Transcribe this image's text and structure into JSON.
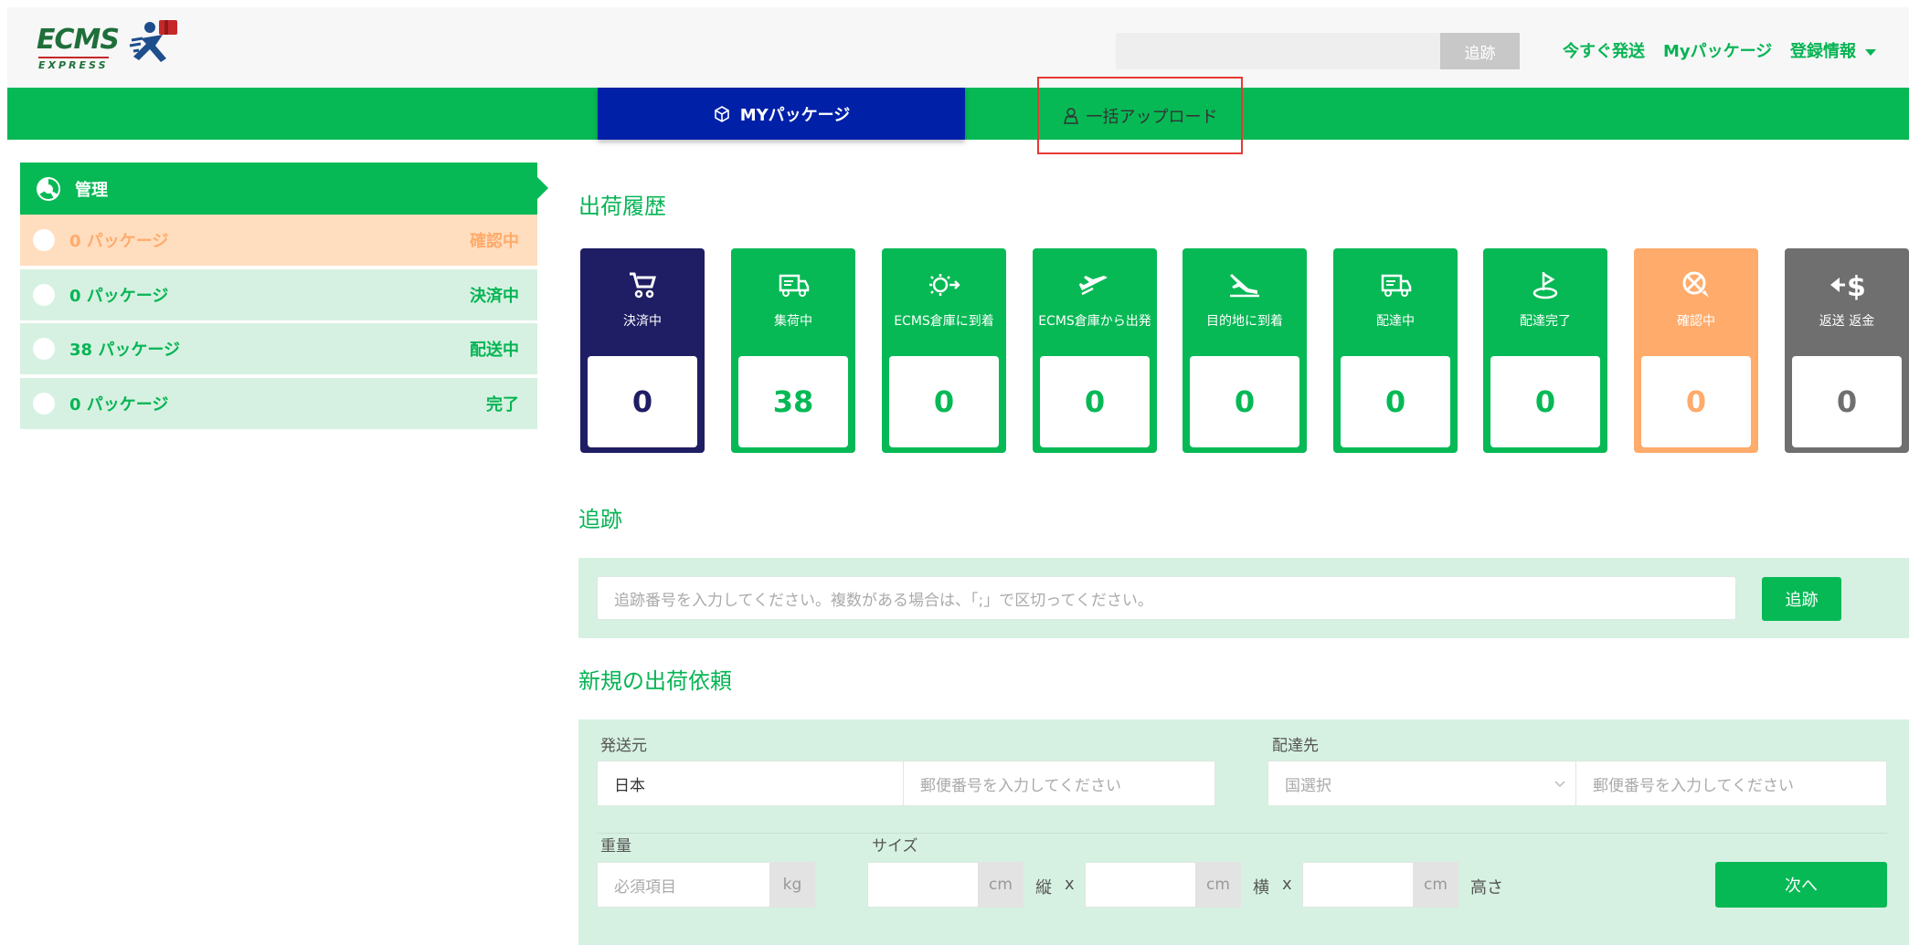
{
  "header": {
    "logo_text": "ECMS",
    "logo_sub": "EXPRESS",
    "search_placeholder": "",
    "search_button": "追跡",
    "nav": [
      "今すぐ発送",
      "Myパッケージ",
      "登録情報"
    ]
  },
  "tabs": {
    "mypackage": "MYパッケージ",
    "upload": "一括アップロード"
  },
  "sidebar": {
    "title": "管理",
    "rows": [
      {
        "count": "0 パッケージ",
        "status": "確認中",
        "tone": "orange"
      },
      {
        "count": "0 パッケージ",
        "status": "決済中",
        "tone": "green"
      },
      {
        "count": "38 パッケージ",
        "status": "配送中",
        "tone": "green"
      },
      {
        "count": "0 パッケージ",
        "status": "完了",
        "tone": "green"
      }
    ]
  },
  "history": {
    "title": "出荷履歴",
    "cards": [
      {
        "label": "決済中",
        "value": "0",
        "color": "#1f1d63",
        "icon": "cart-icon"
      },
      {
        "label": "集荷中",
        "value": "38",
        "color": "#06b955",
        "icon": "truck-icon"
      },
      {
        "label": "ECMS倉庫に到着",
        "value": "0",
        "color": "#06b955",
        "icon": "warehouse-arrive-icon"
      },
      {
        "label": "ECMS倉庫から出発",
        "value": "0",
        "color": "#06b955",
        "icon": "plane-depart-icon"
      },
      {
        "label": "目的地に到着",
        "value": "0",
        "color": "#06b955",
        "icon": "plane-arrive-icon"
      },
      {
        "label": "配達中",
        "value": "0",
        "color": "#06b955",
        "icon": "delivery-truck-icon"
      },
      {
        "label": "配達完了",
        "value": "0",
        "color": "#06b955",
        "icon": "delivered-pin-icon"
      },
      {
        "label": "確認中",
        "value": "0",
        "color": "#ffab6b",
        "icon": "confirm-icon"
      },
      {
        "label": "返送 返金",
        "value": "0",
        "color": "#6f6f6f",
        "icon": "refund-icon"
      }
    ]
  },
  "tracking": {
    "title": "追跡",
    "placeholder": "追跡番号を入力してください。複数がある場合は、「;」で区切ってください。",
    "button": "追跡"
  },
  "shipment": {
    "title": "新規の出荷依頼",
    "from_label": "発送元",
    "from_country": "日本",
    "from_zip_placeholder": "郵便番号を入力してください",
    "to_label": "配達先",
    "to_country_placeholder": "国選択",
    "to_zip_placeholder": "郵便番号を入力してください",
    "weight_label": "重量",
    "weight_placeholder": "必須項目",
    "weight_unit": "kg",
    "size_label": "サイズ",
    "size_unit": "cm",
    "dim_length": "縦",
    "dim_width": "横",
    "dim_height": "高さ",
    "times": "x",
    "next_button": "次へ"
  },
  "colors": {
    "brand_green": "#06b955",
    "navy": "#0020a8",
    "orange": "#ffab6b",
    "highlight_border": "#e53935"
  }
}
